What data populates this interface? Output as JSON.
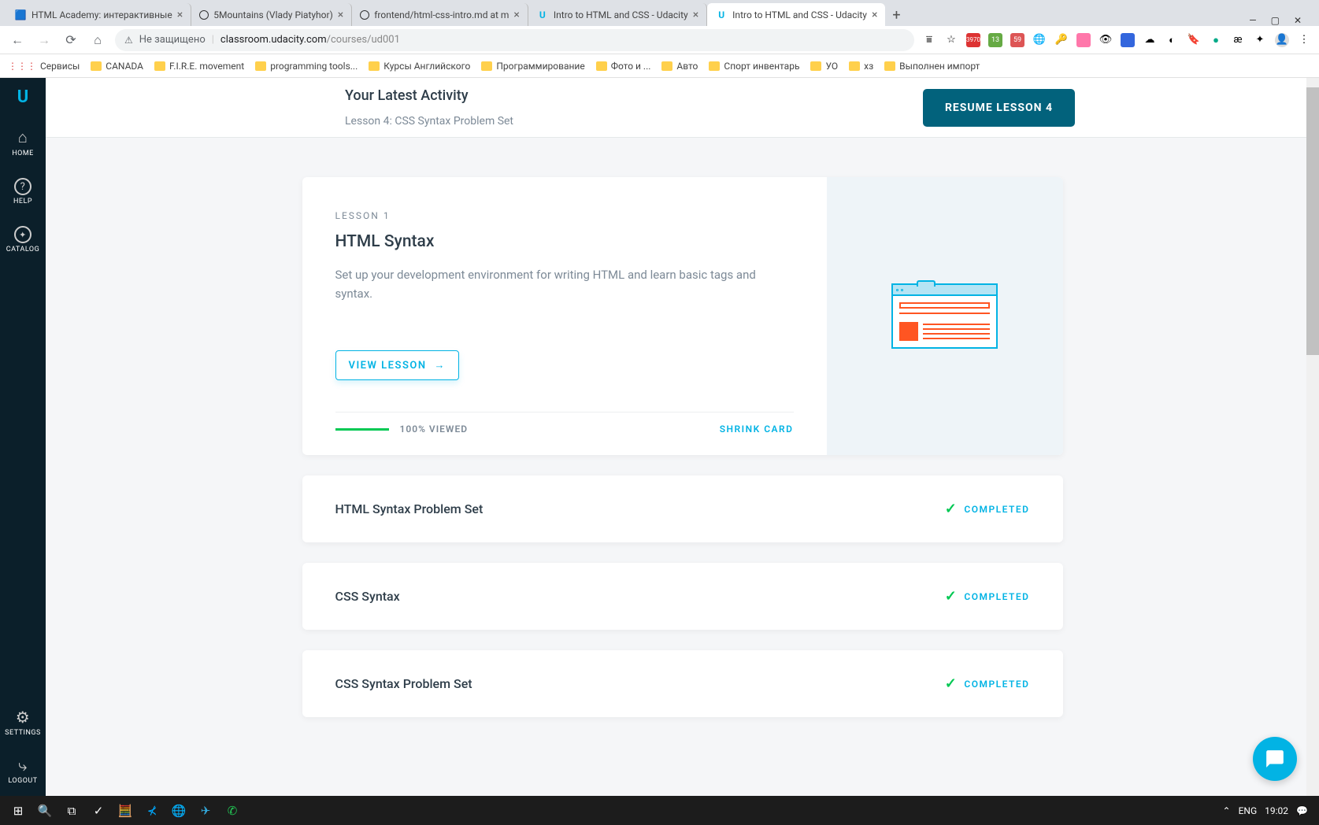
{
  "browser": {
    "tabs": [
      {
        "title": "HTML Academy: интерактивные",
        "favicon": "🟦"
      },
      {
        "title": "5Mountains (Vlady Piatyhor)",
        "favicon": "◯"
      },
      {
        "title": "frontend/html-css-intro.md at m",
        "favicon": "◯"
      },
      {
        "title": "Intro to HTML and CSS - Udacity",
        "favicon": "U"
      },
      {
        "title": "Intro to HTML and CSS - Udacity",
        "favicon": "U",
        "active": true
      }
    ],
    "url_security": "Не защищено",
    "url_domain": "classroom.udacity.com",
    "url_path": "/courses/ud001"
  },
  "bookmarks": [
    "Сервисы",
    "CANADA",
    "F.I.R.E. movement",
    "programming tools...",
    "Курсы Английского",
    "Программирование",
    "Фото и ...",
    "Авто",
    "Спорт инвентарь",
    "УО",
    "хз",
    "Выполнен импорт"
  ],
  "sidebar": {
    "items": [
      {
        "icon": "⌂",
        "label": "HOME"
      },
      {
        "icon": "?",
        "label": "HELP"
      },
      {
        "icon": "◎",
        "label": "CATALOG"
      }
    ],
    "bottom": [
      {
        "icon": "⚙",
        "label": "SETTINGS"
      },
      {
        "icon": "⤷",
        "label": "LOGOUT"
      }
    ]
  },
  "header": {
    "title": "Your Latest Activity",
    "subtitle": "Lesson 4: CSS Syntax Problem Set",
    "resume_btn": "RESUME LESSON 4"
  },
  "expanded_lesson": {
    "number": "LESSON 1",
    "title": "HTML Syntax",
    "description": "Set up your development environment for writing HTML and learn basic tags and syntax.",
    "view_btn": "VIEW LESSON",
    "progress_text": "100% VIEWED",
    "shrink": "SHRINK CARD"
  },
  "compact_lessons": [
    {
      "title": "HTML Syntax Problem Set",
      "status": "COMPLETED"
    },
    {
      "title": "CSS Syntax",
      "status": "COMPLETED"
    },
    {
      "title": "CSS Syntax Problem Set",
      "status": "COMPLETED"
    }
  ],
  "taskbar": {
    "lang": "ENG",
    "time": "19:02"
  }
}
